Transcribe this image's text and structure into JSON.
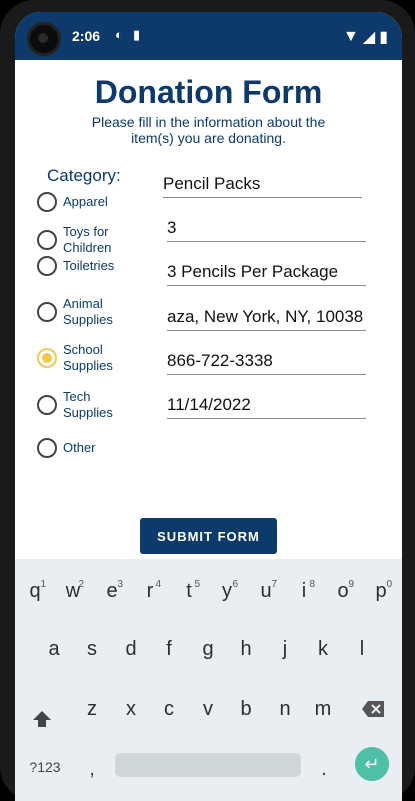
{
  "status_bar": {
    "time": "2:06",
    "icons": {
      "left1": "data-saver-icon",
      "left2": "sd-card-icon",
      "right1": "wifi-icon",
      "right2": "signal-icon",
      "right3": "battery-icon"
    }
  },
  "form": {
    "title": "Donation Form",
    "subtitle": "Please fill in the information about the item(s) you are donating.",
    "category_label": "Category:",
    "categories": [
      {
        "label": "Apparel",
        "checked": false
      },
      {
        "label": "Toys for Children",
        "checked": false
      },
      {
        "label": "Toiletries",
        "checked": false
      },
      {
        "label": "Animal Supplies",
        "checked": false
      },
      {
        "label": "School Supplies",
        "checked": true
      },
      {
        "label": "Tech Supplies",
        "checked": false
      },
      {
        "label": "Other",
        "checked": false
      }
    ],
    "fields": [
      {
        "value": "Pencil Packs"
      },
      {
        "value": "3"
      },
      {
        "value": "3 Pencils Per Package"
      },
      {
        "value": "aza, New York, NY, 10038"
      },
      {
        "value": "866-722-3338"
      },
      {
        "value": "11/14/2022"
      }
    ],
    "submit_label": "SUBMIT FORM"
  },
  "keyboard": {
    "row1": [
      {
        "key": "q",
        "hint": "1"
      },
      {
        "key": "w",
        "hint": "2"
      },
      {
        "key": "e",
        "hint": "3"
      },
      {
        "key": "r",
        "hint": "4"
      },
      {
        "key": "t",
        "hint": "5"
      },
      {
        "key": "y",
        "hint": "6"
      },
      {
        "key": "u",
        "hint": "7"
      },
      {
        "key": "i",
        "hint": "8"
      },
      {
        "key": "o",
        "hint": "9"
      },
      {
        "key": "p",
        "hint": "0"
      }
    ],
    "row2": [
      "a",
      "s",
      "d",
      "f",
      "g",
      "h",
      "j",
      "k",
      "l"
    ],
    "row3": [
      "z",
      "x",
      "c",
      "v",
      "b",
      "n",
      "m"
    ],
    "symbols_key": "?123",
    "comma_key": ",",
    "period_key": ".",
    "shift_icon": "shift-icon",
    "delete_icon": "backspace-icon",
    "enter_icon": "enter-icon"
  },
  "colors": {
    "primary": "#0d3a6a",
    "radio_selected": "#f2c94c",
    "keyboard_bg": "#e8eef1",
    "enter_key": "#4fbfa5"
  }
}
